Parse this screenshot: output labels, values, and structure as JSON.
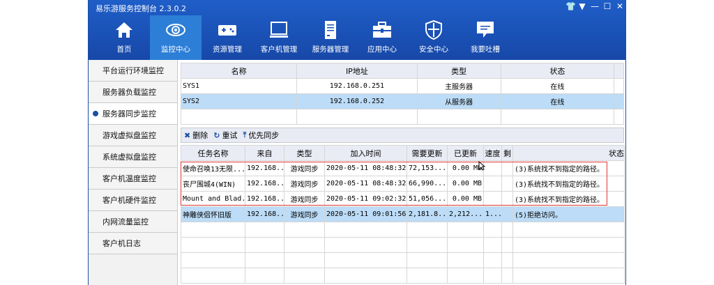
{
  "window": {
    "title": "易乐游服务控制台 2.3.0.2",
    "controls": [
      "skin-icon",
      "dropdown-icon",
      "minimize-icon",
      "maximize-icon",
      "close-icon"
    ]
  },
  "nav": {
    "items": [
      {
        "label": "首页",
        "icon": "home-icon"
      },
      {
        "label": "监控中心",
        "icon": "eye-icon",
        "active": true
      },
      {
        "label": "资源管理",
        "icon": "gamepad-icon"
      },
      {
        "label": "客户机管理",
        "icon": "monitor-icon"
      },
      {
        "label": "服务器管理",
        "icon": "server-icon"
      },
      {
        "label": "应用中心",
        "icon": "toolbox-icon"
      },
      {
        "label": "安全中心",
        "icon": "shield-icon"
      },
      {
        "label": "我要吐槽",
        "icon": "feedback-icon"
      }
    ]
  },
  "sidebar": {
    "items": [
      {
        "label": "平台运行环境监控"
      },
      {
        "label": "服务器负载监控"
      },
      {
        "label": "服务器同步监控",
        "active": true
      },
      {
        "label": "游戏虚拟盘监控"
      },
      {
        "label": "系统虚拟盘监控"
      },
      {
        "label": "客户机温度监控"
      },
      {
        "label": "客户机硬件监控"
      },
      {
        "label": "内网流量监控"
      },
      {
        "label": "客户机日志"
      }
    ]
  },
  "servers": {
    "headers": [
      "名称",
      "IP地址",
      "类型",
      "状态"
    ],
    "rows": [
      {
        "name": "SYS1",
        "ip": "192.168.0.251",
        "type": "主服务器",
        "status": "在线"
      },
      {
        "name": "SYS2",
        "ip": "192.168.0.252",
        "type": "从服务器",
        "status": "在线"
      }
    ]
  },
  "toolbar": {
    "delete": "删除",
    "retry": "重试",
    "priority": "优先同步"
  },
  "tasks": {
    "headers": [
      "任务名称",
      "来自",
      "类型",
      "加入时间",
      "需要更新",
      "已更新",
      "速度",
      "剩",
      "状态"
    ],
    "rows": [
      {
        "name": "使命召唤13无限...",
        "from": "192.168...",
        "type": "游戏同步",
        "time": "2020-05-11 08:48:32",
        "need": "72,153....",
        "done": "0.00 MB",
        "speed": "",
        "left": "",
        "status": "(3)系统找不到指定的路径。"
      },
      {
        "name": "丧尸围城4(WIN)",
        "from": "192.168...",
        "type": "游戏同步",
        "time": "2020-05-11 08:48:32",
        "need": "66,990....",
        "done": "0.00 MB",
        "speed": "",
        "left": "",
        "status": "(3)系统找不到指定的路径。"
      },
      {
        "name": "Mount and Blad...",
        "from": "192.168...",
        "type": "游戏同步",
        "time": "2020-05-11 09:02:32",
        "need": "51,056....",
        "done": "0.00 MB",
        "speed": "",
        "left": "",
        "status": "(3)系统找不到指定的路径。"
      },
      {
        "name": "神雕侠侣怀旧版",
        "from": "192.168...",
        "type": "游戏同步",
        "time": "2020-05-11 09:01:56",
        "need": "2,181.8...",
        "done": "2,212....",
        "speed": "1....",
        "left": "",
        "status": "(5)拒绝访问。"
      }
    ]
  },
  "colors": {
    "header_blue": "#1a52b8",
    "active_nav": "#2d7ed6",
    "selected_row": "#bcdcf7",
    "highlight_border": "#e03434"
  }
}
